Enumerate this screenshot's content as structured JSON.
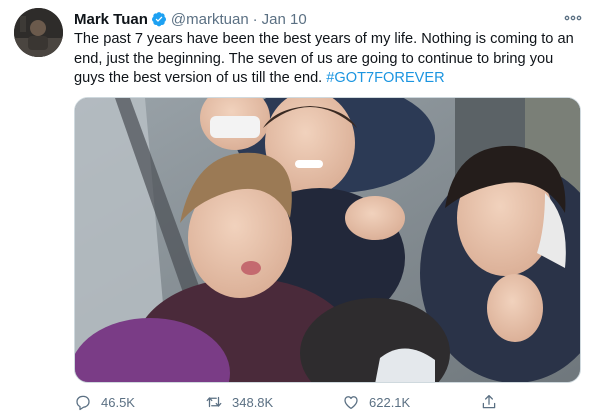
{
  "tweet": {
    "author_name": "Mark Tuan",
    "handle": "@marktuan",
    "separator": "·",
    "date": "Jan 10",
    "text_body": "The past 7 years have been the best years of my life. Nothing is coming to an end, just the beginning. The seven of us are going to continue to bring you guys the best version of us till the end. ",
    "hashtag": "#GOT7FOREVER",
    "media_kind": "photo"
  },
  "actions": {
    "replies": "46.5K",
    "retweets": "348.8K",
    "likes": "622.1K"
  },
  "colors": {
    "link": "#1b95e0",
    "verified": "#1da1f2",
    "muted": "#5b7083"
  },
  "icons": [
    "verified-badge-icon",
    "more-icon",
    "reply-icon",
    "retweet-icon",
    "like-icon",
    "share-icon"
  ]
}
